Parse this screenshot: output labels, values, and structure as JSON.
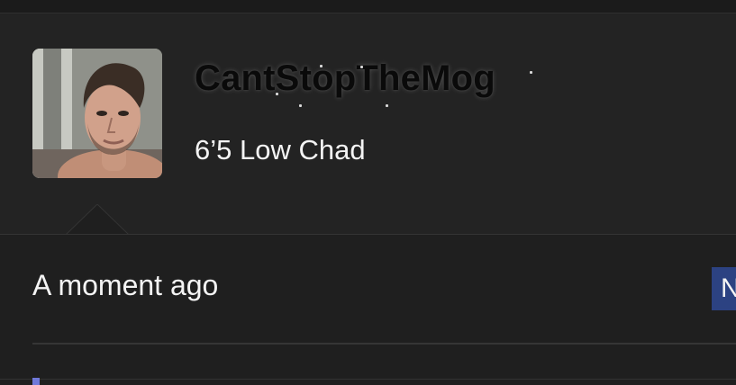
{
  "profile": {
    "username": "CantStopTheMog",
    "subtitle": "6’5 Low Chad",
    "avatar_icon": "profile-photo"
  },
  "post": {
    "timestamp": "A moment ago",
    "badge_label": "N",
    "badge_color": "#2c4282"
  },
  "colors": {
    "background": "#232323",
    "post_background": "#1f1f1f",
    "accent": "#6f78d9"
  }
}
